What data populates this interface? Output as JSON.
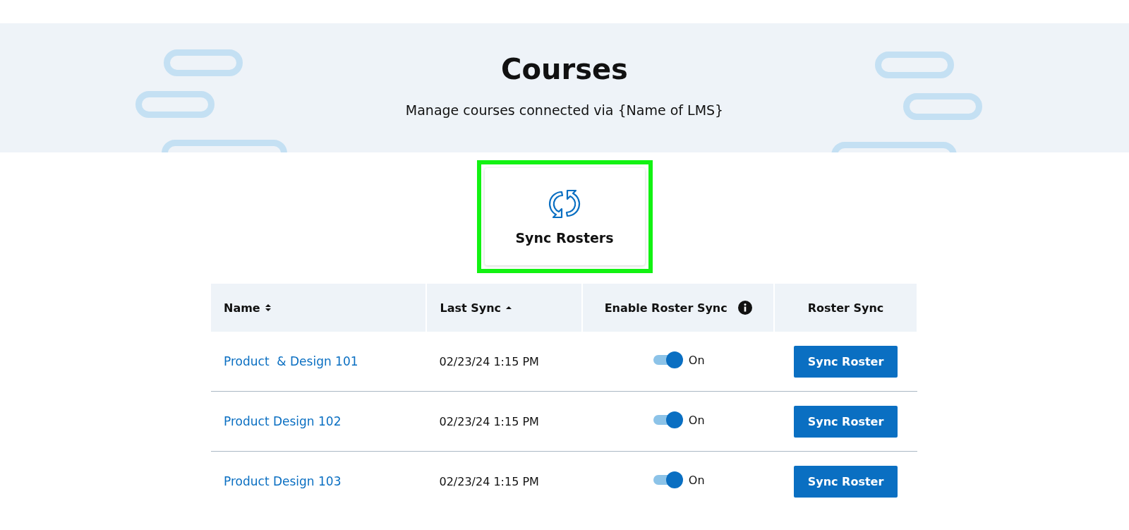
{
  "header": {
    "title": "Courses",
    "subtitle": "Manage courses connected via {Name of LMS}"
  },
  "action_card": {
    "label": "Sync Rosters",
    "highlighted": true
  },
  "table": {
    "columns": [
      {
        "label": "Name",
        "kind": "sortable"
      },
      {
        "label": "Last Sync",
        "kind": "sorted-ascending"
      },
      {
        "label": "Enable Roster Sync",
        "kind": "info"
      },
      {
        "label": "Roster Sync",
        "kind": "plain"
      }
    ],
    "rows": [
      {
        "name": "Product  & Design 101",
        "last_sync": "02/23/24 1:15 PM",
        "on": true,
        "toggle_label": "On",
        "button": "Sync Roster"
      },
      {
        "name": "Product Design 102",
        "last_sync": "02/23/24 1:15 PM",
        "on": true,
        "toggle_label": "On",
        "button": "Sync Roster"
      },
      {
        "name": "Product Design 103",
        "last_sync": "02/23/24 1:15 PM",
        "on": true,
        "toggle_label": "On",
        "button": "Sync Roster"
      }
    ]
  }
}
